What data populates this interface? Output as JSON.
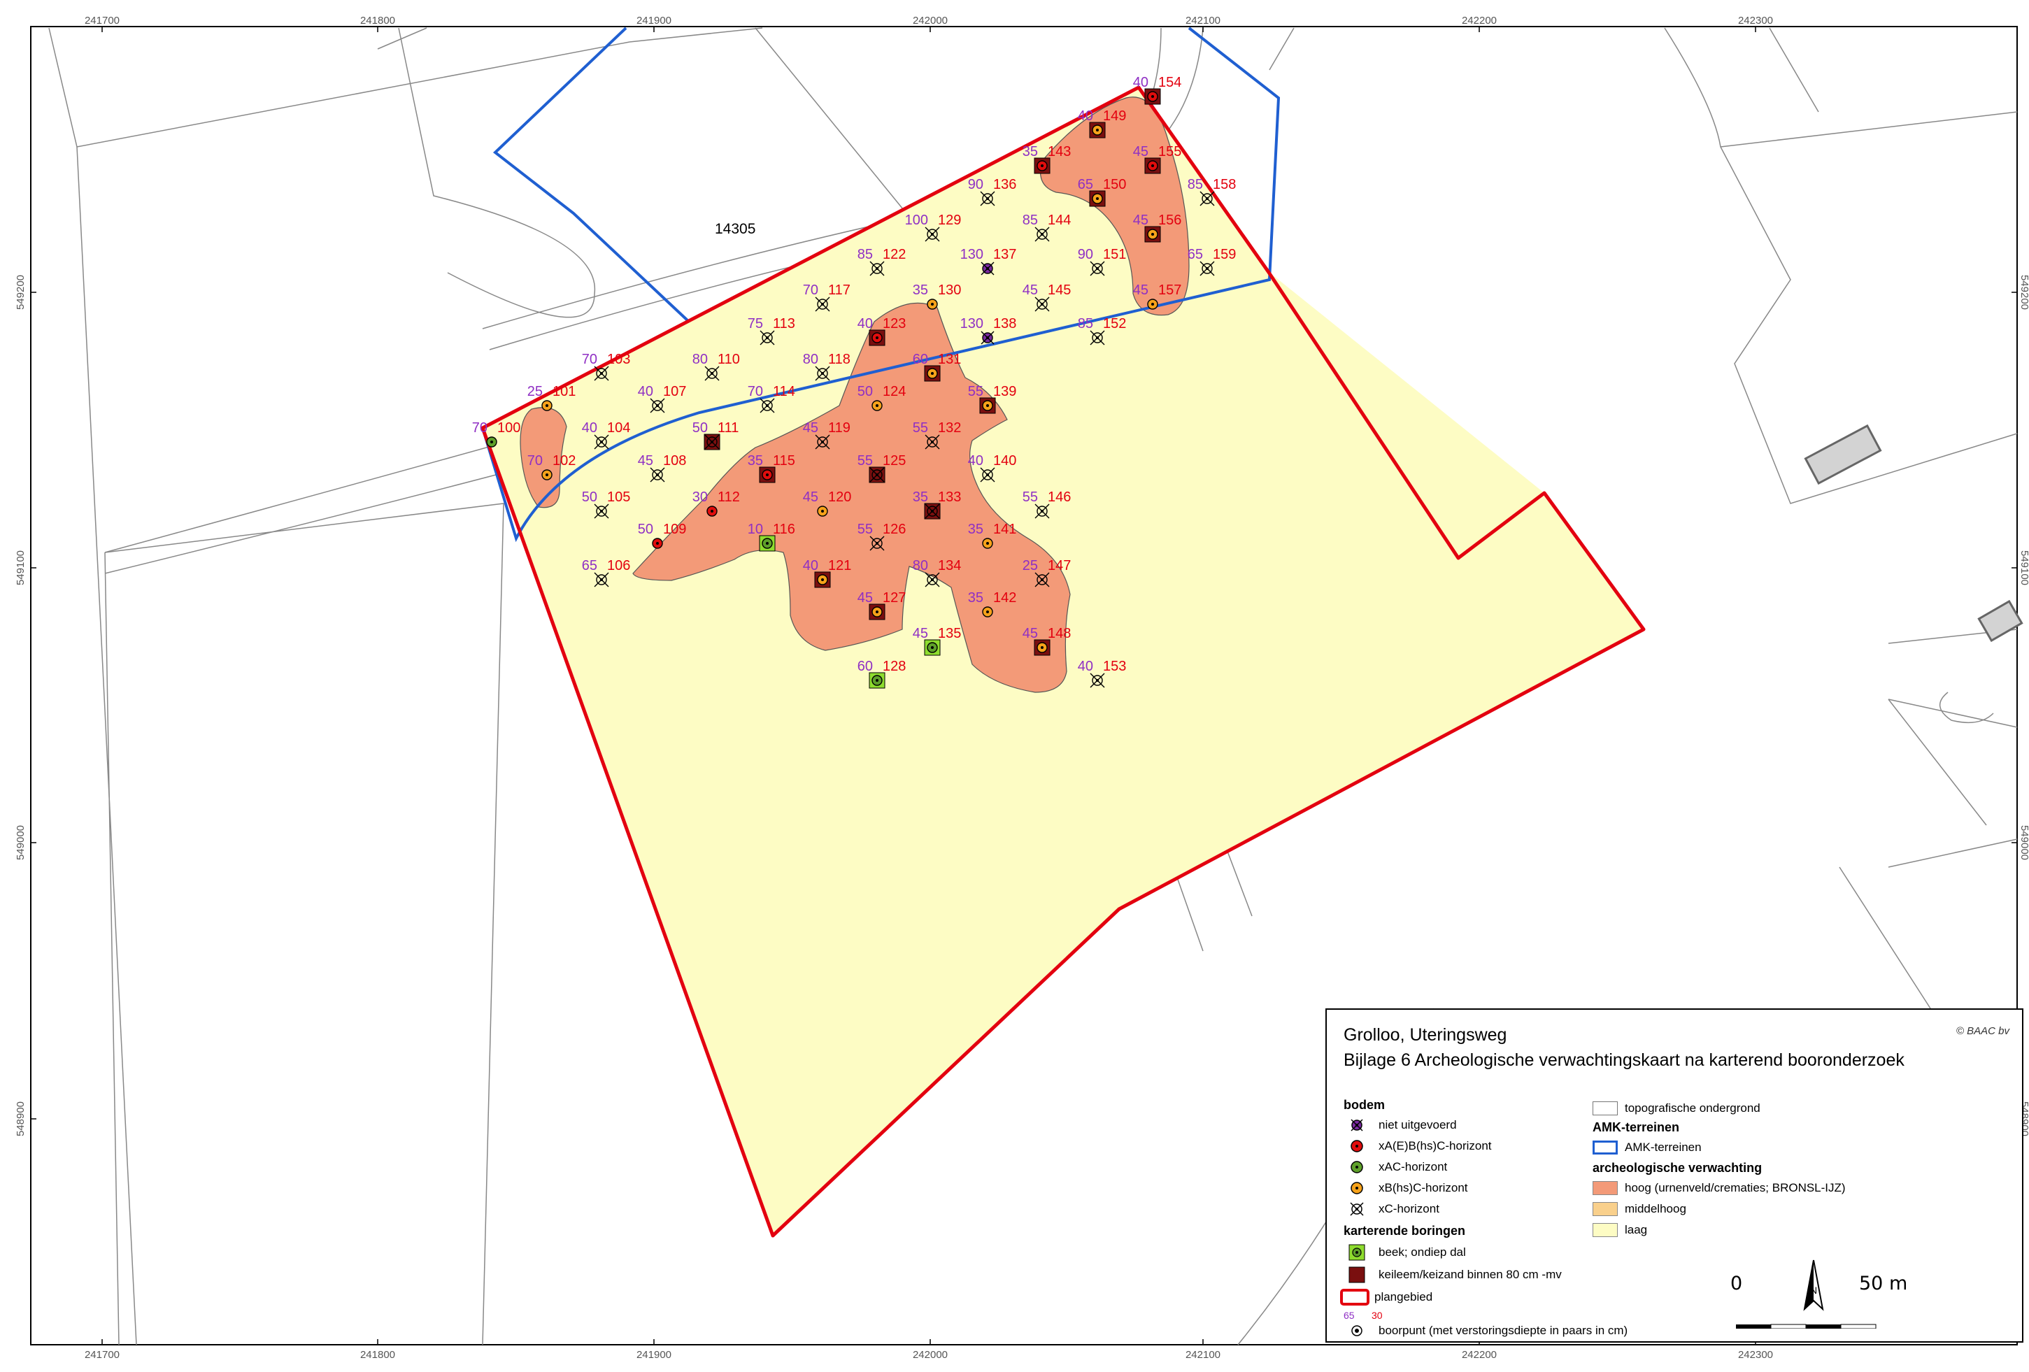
{
  "colors": {
    "plan_area_stroke": "#e3000f",
    "amk_stroke": "#1f5fd1",
    "low_fill": "#fdfcc4",
    "high_fill": "#f39a78",
    "mid_fill": "#f9d08c",
    "depth_label": "#8f2fc4",
    "number_label": "#e3000f",
    "point_orange": "#f6a21a",
    "point_red": "#e00d0d",
    "point_green": "#5ea02a",
    "point_purple": "#7a2aa0",
    "peat_green": "#8edc2e",
    "keileem_dark": "#7a0f0f",
    "topo_line": "#888888",
    "building_fill": "#d3d3d3"
  },
  "grid": {
    "x_ticks": [
      "241700",
      "241800",
      "241900",
      "242000",
      "242100",
      "242200",
      "242300"
    ],
    "y_ticks": [
      "549200",
      "549100",
      "549000",
      "548900"
    ]
  },
  "parcel_label": "14305",
  "legend": {
    "title": "Grolloo, Uteringsweg",
    "subtitle": "Bijlage 6 Archeologische verwachtingskaart na karterend booronderzoek",
    "copyright": "© BAAC bv",
    "bodem_heading": "bodem",
    "bodem_items": [
      {
        "type": "purple",
        "label": "niet uitgevoerd"
      },
      {
        "type": "red",
        "label": "xA(E)B(hs)C-horizont"
      },
      {
        "type": "green",
        "label": "xAC-horizont"
      },
      {
        "type": "orange",
        "label": "xB(hs)C-horizont"
      },
      {
        "type": "cross",
        "label": "xC-horizont"
      }
    ],
    "karterend_heading": "karterende boringen",
    "karterend_items": [
      {
        "type": "peat",
        "label": "beek; ondiep dal"
      },
      {
        "type": "keileem",
        "label": "keileem/keizand binnen 80 cm -mv"
      },
      {
        "type": "plan",
        "label": "plangebied"
      }
    ],
    "boorpunt": {
      "depth": "65",
      "number": "30",
      "label": "boorpunt (met verstoringsdiepte in paars in cm)"
    },
    "right_items": {
      "topo": "topografische ondergrond",
      "amk_heading": "AMK-terreinen",
      "amk": "AMK-terreinen",
      "verwachting_heading": "archeologische verwachting",
      "hoog": "hoog (urnenveld/crematies; BRONSL-IJZ)",
      "middelhoog": "middelhoog",
      "laag": "laag"
    }
  },
  "scalebar": {
    "zero": "0",
    "max": "50 m"
  },
  "north_label": "N",
  "points": [
    {
      "nr": "100",
      "depth": "70",
      "type": "green"
    },
    {
      "nr": "101",
      "depth": "25",
      "type": "orange"
    },
    {
      "nr": "102",
      "depth": "70",
      "type": "orange"
    },
    {
      "nr": "103",
      "depth": "70",
      "type": "cross"
    },
    {
      "nr": "104",
      "depth": "40",
      "type": "cross"
    },
    {
      "nr": "105",
      "depth": "50",
      "type": "cross"
    },
    {
      "nr": "106",
      "depth": "65",
      "type": "cross"
    },
    {
      "nr": "107",
      "depth": "40",
      "type": "cross"
    },
    {
      "nr": "108",
      "depth": "45",
      "type": "cross"
    },
    {
      "nr": "109",
      "depth": "50",
      "type": "red"
    },
    {
      "nr": "110",
      "depth": "80",
      "type": "cross"
    },
    {
      "nr": "111",
      "depth": "50",
      "type": "cross",
      "keileem": true
    },
    {
      "nr": "112",
      "depth": "30",
      "type": "red"
    },
    {
      "nr": "113",
      "depth": "75",
      "type": "cross"
    },
    {
      "nr": "114",
      "depth": "70",
      "type": "cross"
    },
    {
      "nr": "115",
      "depth": "35",
      "type": "red",
      "keileem": true
    },
    {
      "nr": "116",
      "depth": "10",
      "type": "green",
      "peat": true
    },
    {
      "nr": "117",
      "depth": "70",
      "type": "cross"
    },
    {
      "nr": "118",
      "depth": "80",
      "type": "cross"
    },
    {
      "nr": "119",
      "depth": "45",
      "type": "cross"
    },
    {
      "nr": "120",
      "depth": "45",
      "type": "orange"
    },
    {
      "nr": "121",
      "depth": "40",
      "type": "orange",
      "keileem": true
    },
    {
      "nr": "122",
      "depth": "85",
      "type": "cross"
    },
    {
      "nr": "123",
      "depth": "40",
      "type": "red",
      "keileem": true
    },
    {
      "nr": "124",
      "depth": "50",
      "type": "orange"
    },
    {
      "nr": "125",
      "depth": "55",
      "type": "cross",
      "keileem": true
    },
    {
      "nr": "126",
      "depth": "55",
      "type": "cross"
    },
    {
      "nr": "127",
      "depth": "45",
      "type": "orange",
      "keileem": true
    },
    {
      "nr": "128",
      "depth": "60",
      "type": "green",
      "peat": true
    },
    {
      "nr": "129",
      "depth": "100",
      "type": "cross"
    },
    {
      "nr": "130",
      "depth": "35",
      "type": "orange"
    },
    {
      "nr": "131",
      "depth": "60",
      "type": "orange",
      "keileem": true
    },
    {
      "nr": "132",
      "depth": "55",
      "type": "cross"
    },
    {
      "nr": "133",
      "depth": "35",
      "type": "cross",
      "keileem": true
    },
    {
      "nr": "134",
      "depth": "80",
      "type": "cross"
    },
    {
      "nr": "135",
      "depth": "45",
      "type": "green",
      "peat": true
    },
    {
      "nr": "136",
      "depth": "90",
      "type": "cross"
    },
    {
      "nr": "137",
      "depth": "130",
      "type": "purple"
    },
    {
      "nr": "138",
      "depth": "130",
      "type": "purple"
    },
    {
      "nr": "139",
      "depth": "55",
      "type": "orange",
      "keileem": true
    },
    {
      "nr": "140",
      "depth": "40",
      "type": "cross"
    },
    {
      "nr": "141",
      "depth": "35",
      "type": "orange"
    },
    {
      "nr": "142",
      "depth": "35",
      "type": "orange"
    },
    {
      "nr": "143",
      "depth": "35",
      "type": "red",
      "keileem": true
    },
    {
      "nr": "144",
      "depth": "85",
      "type": "cross"
    },
    {
      "nr": "145",
      "depth": "45",
      "type": "cross"
    },
    {
      "nr": "146",
      "depth": "55",
      "type": "cross"
    },
    {
      "nr": "147",
      "depth": "25",
      "type": "cross"
    },
    {
      "nr": "148",
      "depth": "45",
      "type": "orange",
      "keileem": true
    },
    {
      "nr": "149",
      "depth": "40",
      "type": "orange",
      "keileem": true
    },
    {
      "nr": "150",
      "depth": "65",
      "type": "orange",
      "keileem": true
    },
    {
      "nr": "151",
      "depth": "90",
      "type": "cross"
    },
    {
      "nr": "152",
      "depth": "85",
      "type": "cross"
    },
    {
      "nr": "153",
      "depth": "40",
      "type": "cross"
    },
    {
      "nr": "154",
      "depth": "40",
      "type": "red",
      "keileem": true
    },
    {
      "nr": "155",
      "depth": "45",
      "type": "red",
      "keileem": true
    },
    {
      "nr": "156",
      "depth": "45",
      "type": "orange",
      "keileem": true
    },
    {
      "nr": "157",
      "depth": "45",
      "type": "orange"
    },
    {
      "nr": "158",
      "depth": "85",
      "type": "cross"
    },
    {
      "nr": "159",
      "depth": "65",
      "type": "cross"
    }
  ]
}
